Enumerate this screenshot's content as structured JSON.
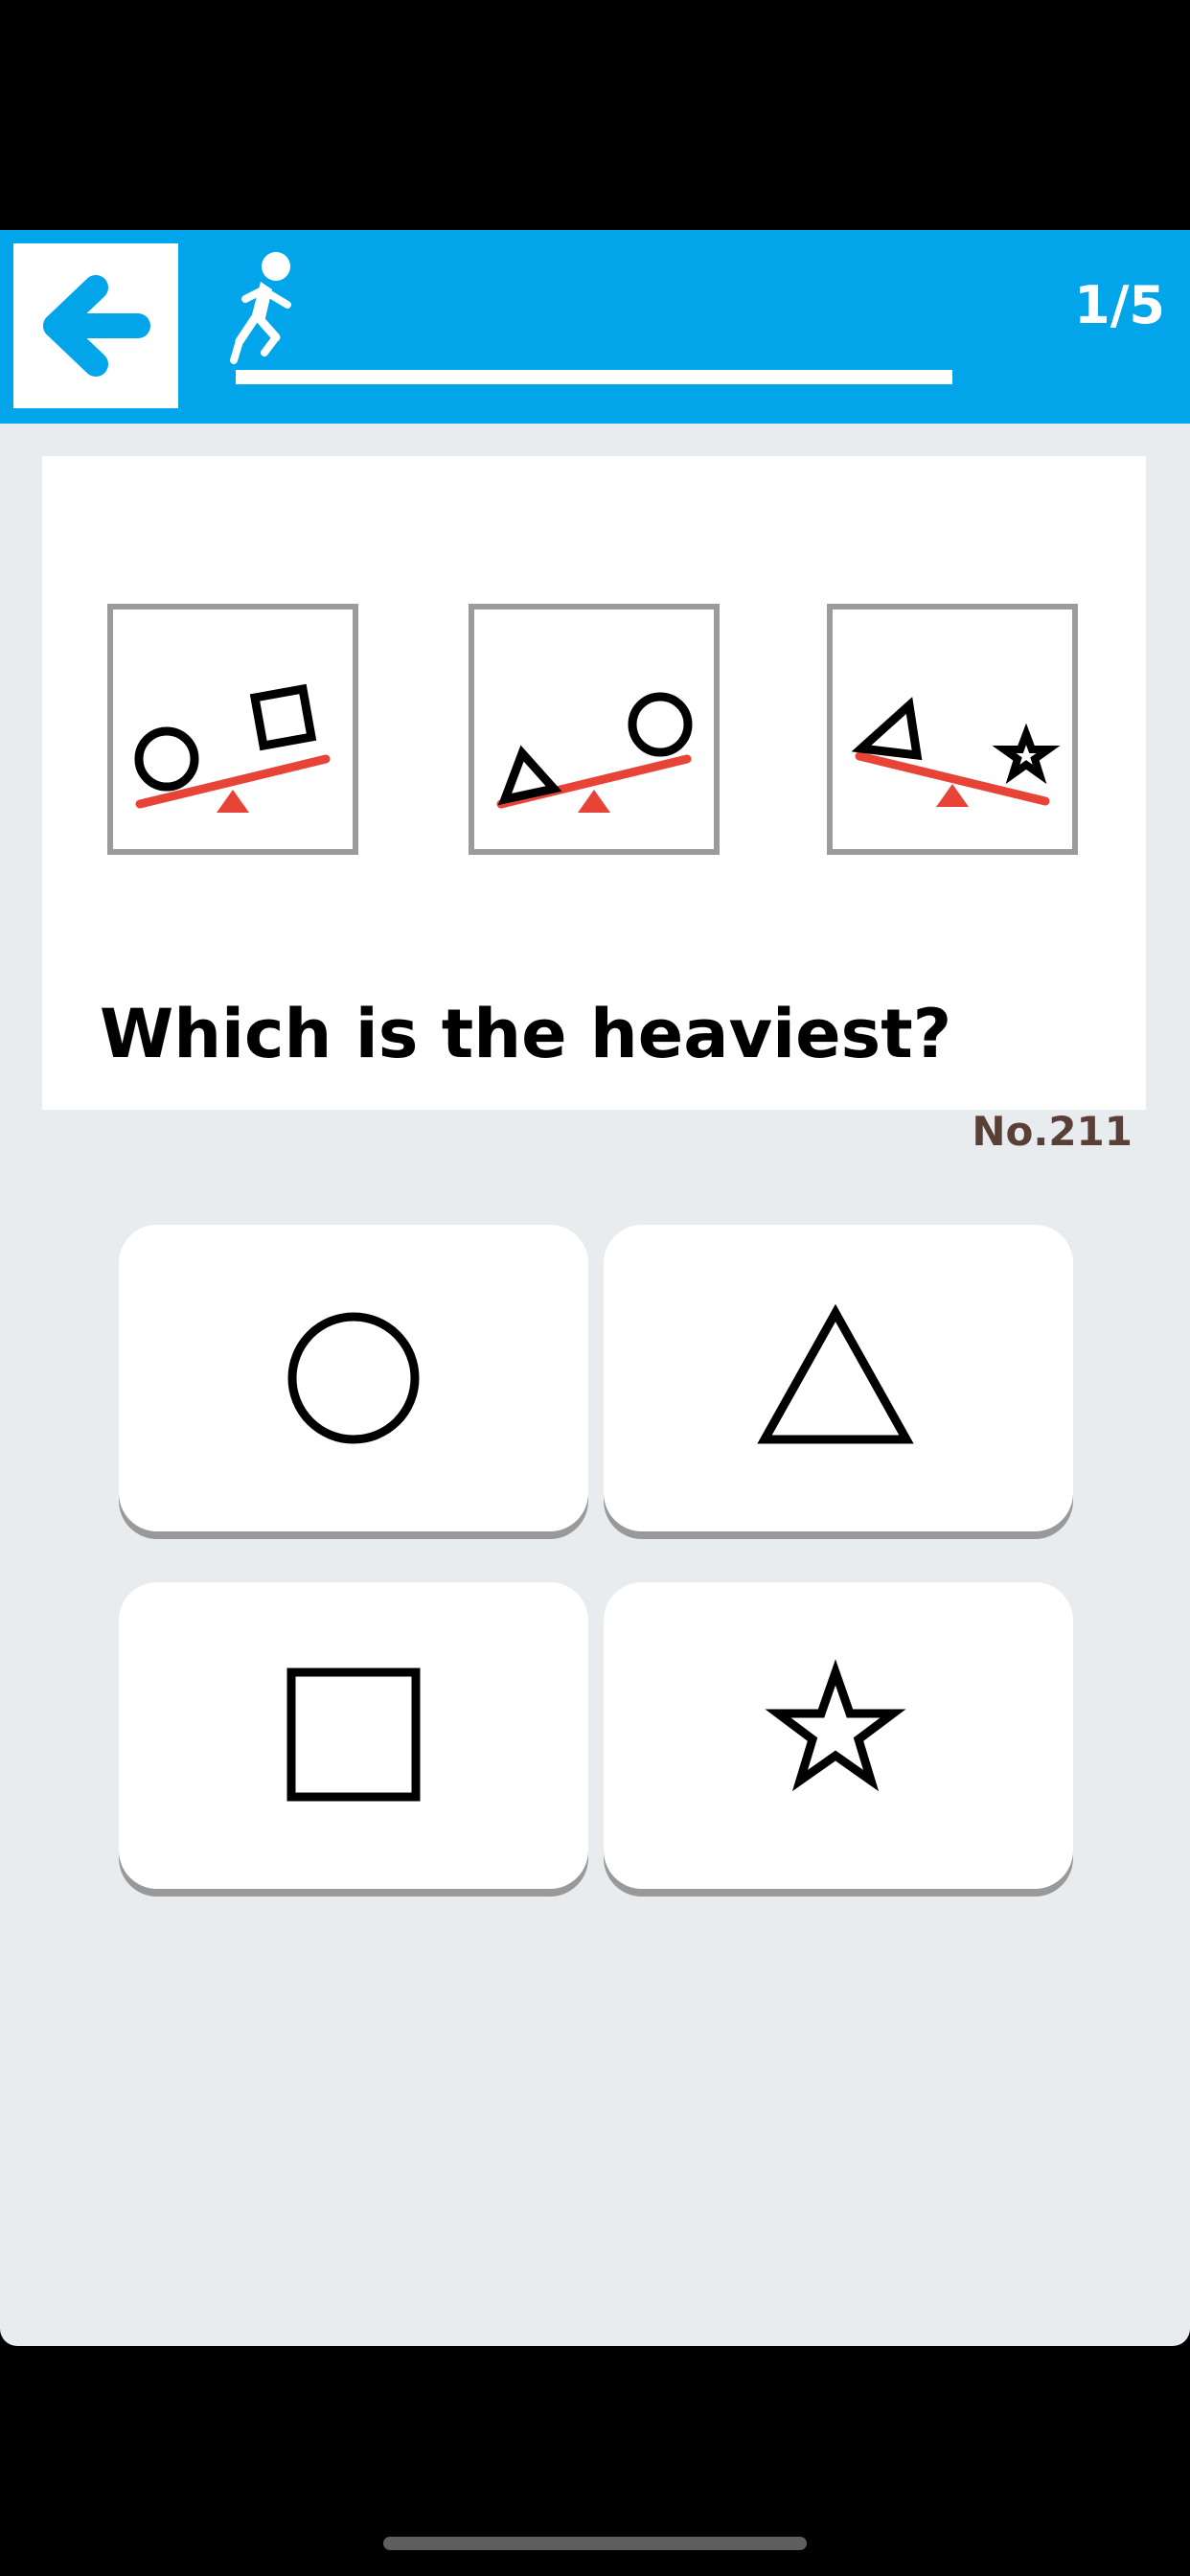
{
  "header": {
    "back_icon": "arrow-left-icon",
    "runner_icon": "running-person-icon",
    "progress": {
      "current": 1,
      "total": 5,
      "label": "1/5"
    },
    "colors": {
      "bar": "#03a5ea",
      "accent": "#ffffff"
    }
  },
  "question": {
    "text": "Which is the heaviest?",
    "number_label": "No.211",
    "scenes": [
      {
        "left": "circle",
        "right": "square",
        "heavier": "circle"
      },
      {
        "left": "triangle",
        "right": "circle",
        "heavier": "triangle"
      },
      {
        "left": "triangle",
        "right": "star",
        "heavier": "star"
      }
    ],
    "colors": {
      "seesaw": "#e84337",
      "frame": "#9b9b9b"
    }
  },
  "answers": [
    {
      "id": "circle",
      "icon": "circle-outline-icon"
    },
    {
      "id": "triangle",
      "icon": "triangle-outline-icon"
    },
    {
      "id": "square",
      "icon": "square-outline-icon"
    },
    {
      "id": "star",
      "icon": "star-outline-icon"
    }
  ]
}
